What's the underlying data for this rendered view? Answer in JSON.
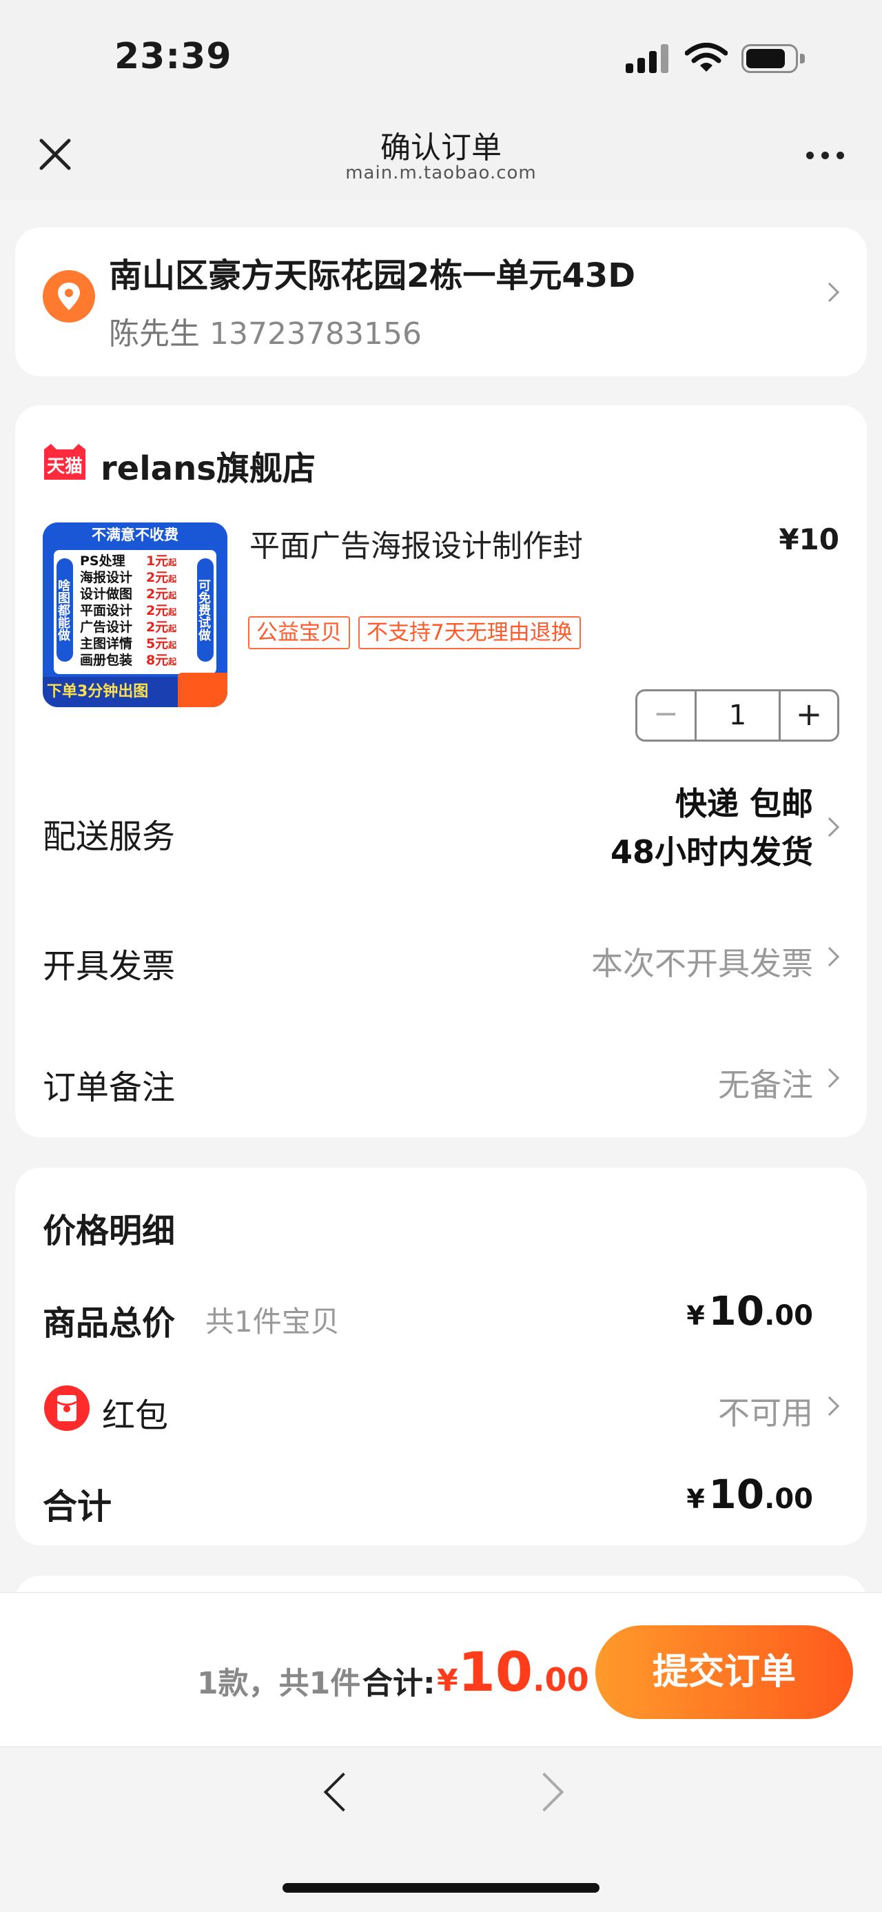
{
  "status_bar": {
    "time": "23:39"
  },
  "header": {
    "title": "确认订单",
    "url": "main.m.taobao.com"
  },
  "address": {
    "line": "南山区豪方天际花园2栋一单元43D",
    "name": "陈先生",
    "phone": "13723783156"
  },
  "shop": {
    "badge": "天猫",
    "name": "relans旗舰店",
    "product": {
      "title": "平面广告海报设计制作封",
      "price": "¥10",
      "tags": [
        "公益宝贝",
        "不支持7天无理由退换"
      ],
      "quantity": "1",
      "image": {
        "header": "不满意不收费",
        "left": "啥图都能做",
        "right": "可免费试做",
        "items": [
          {
            "name": "PS处理",
            "price": "1元"
          },
          {
            "name": "海报设计",
            "price": "2元"
          },
          {
            "name": "设计做图",
            "price": "2元"
          },
          {
            "name": "平面设计",
            "price": "2元"
          },
          {
            "name": "广告设计",
            "price": "2元"
          },
          {
            "name": "主图详情",
            "price": "5元"
          },
          {
            "name": "画册包装",
            "price": "8元"
          }
        ],
        "unit": "起",
        "footer": "下单3分钟出图"
      }
    }
  },
  "delivery": {
    "label": "配送服务",
    "line1": "快递 包邮",
    "line2": "48小时内发货"
  },
  "invoice": {
    "label": "开具发票",
    "value": "本次不开具发票"
  },
  "note": {
    "label": "订单备注",
    "value": "无备注"
  },
  "price_detail": {
    "title": "价格明细",
    "subtotal_label": "商品总价",
    "subtotal_count": "共1件宝贝",
    "subtotal": {
      "currency": "¥",
      "integer": "10",
      "decimal": ".00"
    },
    "redpacket_label": "红包",
    "redpacket_value": "不可用",
    "total_label": "合计",
    "total": {
      "currency": "¥",
      "integer": "10",
      "decimal": ".00"
    }
  },
  "bottom": {
    "count": "1款，共1件",
    "total_label": "合计:",
    "total": {
      "currency": "¥",
      "integer": "10",
      "decimal": ".00"
    },
    "submit": "提交订单"
  },
  "colors": {
    "accent": "#ff5a1c",
    "price_red": "#ff3d1a",
    "tag_orange": "#ff5a2b"
  }
}
